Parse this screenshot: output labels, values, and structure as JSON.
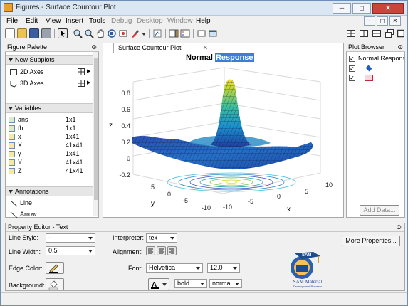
{
  "window": {
    "title": "Figures - Surface Countour Plot",
    "controls": {
      "minimize": "─",
      "restore": "◻",
      "close": "✕",
      "min2": "─",
      "max2": "◻",
      "close2": "✕"
    }
  },
  "menu": [
    "File",
    "Edit",
    "View",
    "Insert",
    "Tools",
    "Debug",
    "Desktop",
    "Window",
    "Help"
  ],
  "menu_disabled": [
    "Debug",
    "Desktop",
    "Window"
  ],
  "palette": {
    "title": "Figure Palette",
    "new_subplots": "New Subplots",
    "axes_2d": "2D Axes",
    "axes_3d": "3D Axes",
    "variables": "Variables",
    "vars": [
      {
        "name": "ans",
        "size": "1x1"
      },
      {
        "name": "fh",
        "size": "1x1"
      },
      {
        "name": "x",
        "size": "1x41"
      },
      {
        "name": "X",
        "size": "41x41"
      },
      {
        "name": "y",
        "size": "1x41"
      },
      {
        "name": "Y",
        "size": "41x41"
      },
      {
        "name": "Z",
        "size": "41x41"
      }
    ],
    "annotations": "Annotations",
    "line": "Line",
    "arrow": "Arrow"
  },
  "tab": {
    "label": "Surface Countour Plot",
    "close": "✕"
  },
  "plot": {
    "title_a": "Normal",
    "title_b": "Response",
    "zlabel": "z",
    "ylabel": "y",
    "xlabel": "x",
    "zticks": [
      "0.8",
      "0.6",
      "0.4",
      "0.2",
      "0",
      "-0.2"
    ],
    "yticks": [
      "5",
      "0",
      "-5",
      "-10"
    ],
    "xticks": [
      "-10",
      "-5",
      "0",
      "5",
      "10"
    ]
  },
  "browser": {
    "title": "Plot Browser",
    "item": "Normal Respons",
    "add_data": "Add Data..."
  },
  "editor": {
    "title": "Property Editor - Text",
    "line_style_label": "Line Style:",
    "line_style_value": "-",
    "line_width_label": "Line Width:",
    "line_width_value": "0.5",
    "edge_color_label": "Edge Color:",
    "background_label": "Background:",
    "interpreter_label": "Interpreter:",
    "interpreter_value": "tex",
    "alignment_label": "Alignment:",
    "font_label": "Font:",
    "font_value": "Helvetica",
    "font_size": "12.0",
    "weight": "bold",
    "angle": "normal",
    "more": "More Properties..."
  },
  "logo": {
    "top": "SAM",
    "name": "SAM Material",
    "tag": "Development Pioneers"
  }
}
